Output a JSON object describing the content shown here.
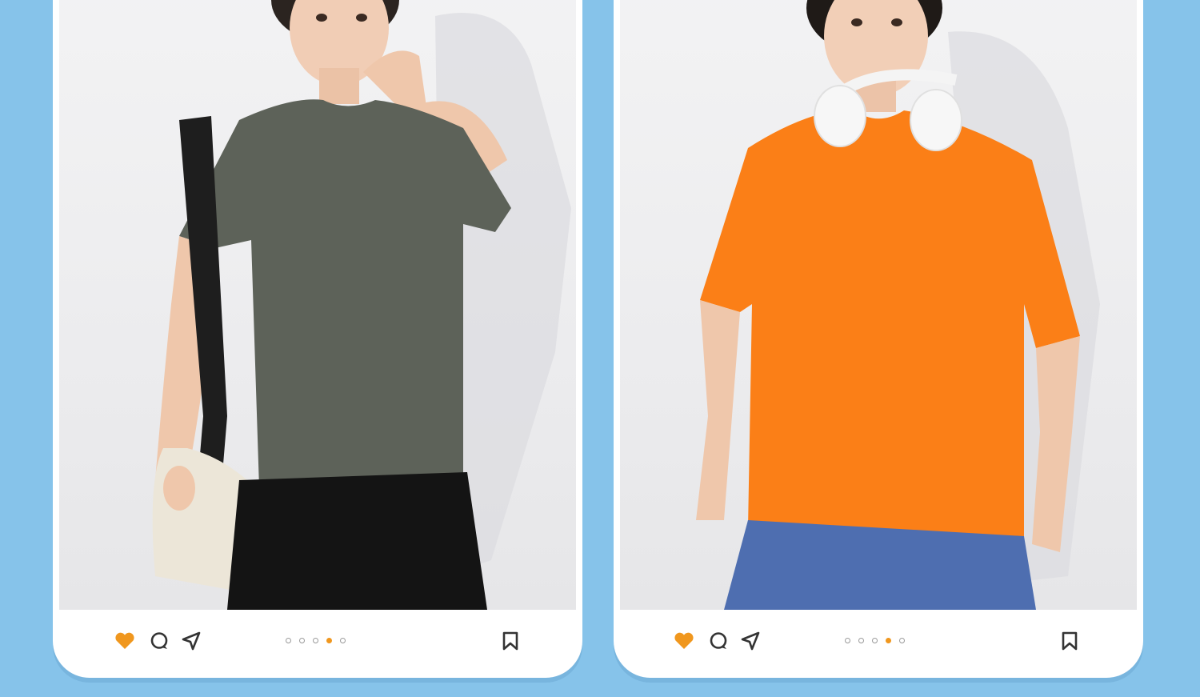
{
  "colors": {
    "background": "#86c3ea",
    "card": "#ffffff",
    "like": "#f0971e",
    "icon": "#333333",
    "active_dot": "#f0971e"
  },
  "cards": [
    {
      "product": "gray-tshirt",
      "shirt_color": "#5d6259",
      "liked": true,
      "carousel": {
        "total": 5,
        "active_index": 3
      },
      "icons": [
        "heart-icon",
        "comment-icon",
        "send-icon",
        "bookmark-icon"
      ]
    },
    {
      "product": "orange-tshirt",
      "shirt_color": "#fb7f17",
      "liked": true,
      "carousel": {
        "total": 5,
        "active_index": 3
      },
      "icons": [
        "heart-icon",
        "comment-icon",
        "send-icon",
        "bookmark-icon"
      ]
    }
  ]
}
